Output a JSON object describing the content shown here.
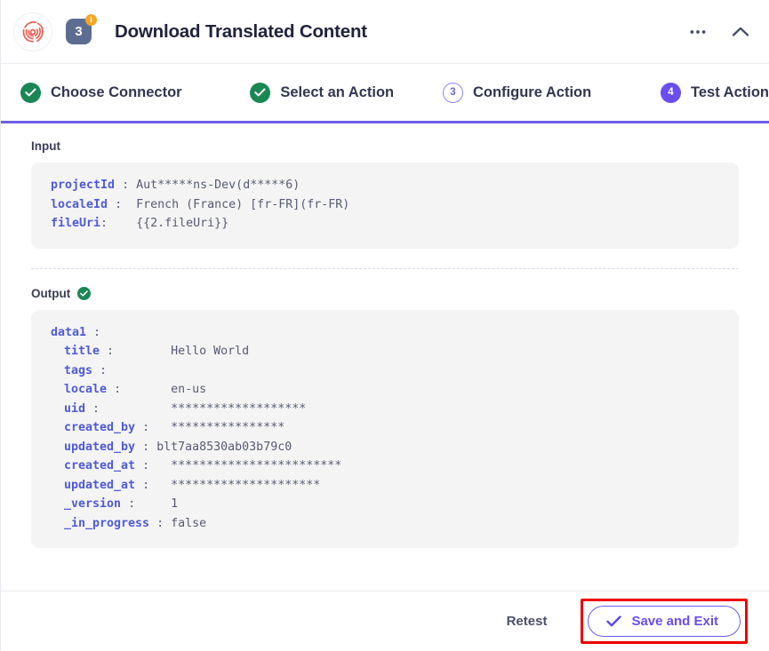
{
  "header": {
    "logo_icon": "fingerprint-logo-icon",
    "step_number": "3",
    "info_badge": "i",
    "title": "Download Translated Content",
    "more_icon": "ellipsis-icon",
    "collapse_icon": "chevron-up-icon"
  },
  "steps": [
    {
      "label": "Choose Connector",
      "state": "done",
      "marker": "✓"
    },
    {
      "label": "Select an Action",
      "state": "done",
      "marker": "✓"
    },
    {
      "label": "Configure Action",
      "state": "current",
      "marker": "3"
    },
    {
      "label": "Test Action",
      "state": "active",
      "marker": "4"
    }
  ],
  "input": {
    "label": "Input",
    "rows": [
      {
        "key": "projectId",
        "colon": ":",
        "value": "Aut*****ns-Dev(d*****6)"
      },
      {
        "key": "localeId",
        "colon": ":",
        "value": "French (France) [fr-FR](fr-FR)"
      },
      {
        "key": "fileUri",
        "colon": ":",
        "value": "{{2.fileUri}}"
      }
    ]
  },
  "output": {
    "label": "Output",
    "status_icon": "check-circle-icon",
    "root": {
      "key": "data1",
      "colon": ":",
      "value": ""
    },
    "rows": [
      {
        "key": "title",
        "colon": ":",
        "value": "Hello World"
      },
      {
        "key": "tags",
        "colon": ":",
        "value": ""
      },
      {
        "key": "locale",
        "colon": ":",
        "value": "en-us"
      },
      {
        "key": "uid",
        "colon": ":",
        "value": "*******************"
      },
      {
        "key": "created_by",
        "colon": ":",
        "value": "****************"
      },
      {
        "key": "updated_by",
        "colon": ":",
        "value": "blt7aa8530ab03b79c0"
      },
      {
        "key": "created_at",
        "colon": ":",
        "value": "************************"
      },
      {
        "key": "updated_at",
        "colon": ":",
        "value": "*********************"
      },
      {
        "key": "_version",
        "colon": ":",
        "value": "1"
      },
      {
        "key": "_in_progress",
        "colon": ":",
        "value": "false"
      }
    ]
  },
  "footer": {
    "retest_label": "Retest",
    "save_label": "Save and Exit",
    "save_check_icon": "check-icon",
    "highlight_color": "#ee0000"
  },
  "colors": {
    "accent_purple": "#6c5ce7",
    "success_green": "#1a8754",
    "key_blue": "#4f5bd5",
    "badge_orange": "#f5a623",
    "logo_coral": "#e8635a",
    "code_bg": "#f4f4f5"
  }
}
